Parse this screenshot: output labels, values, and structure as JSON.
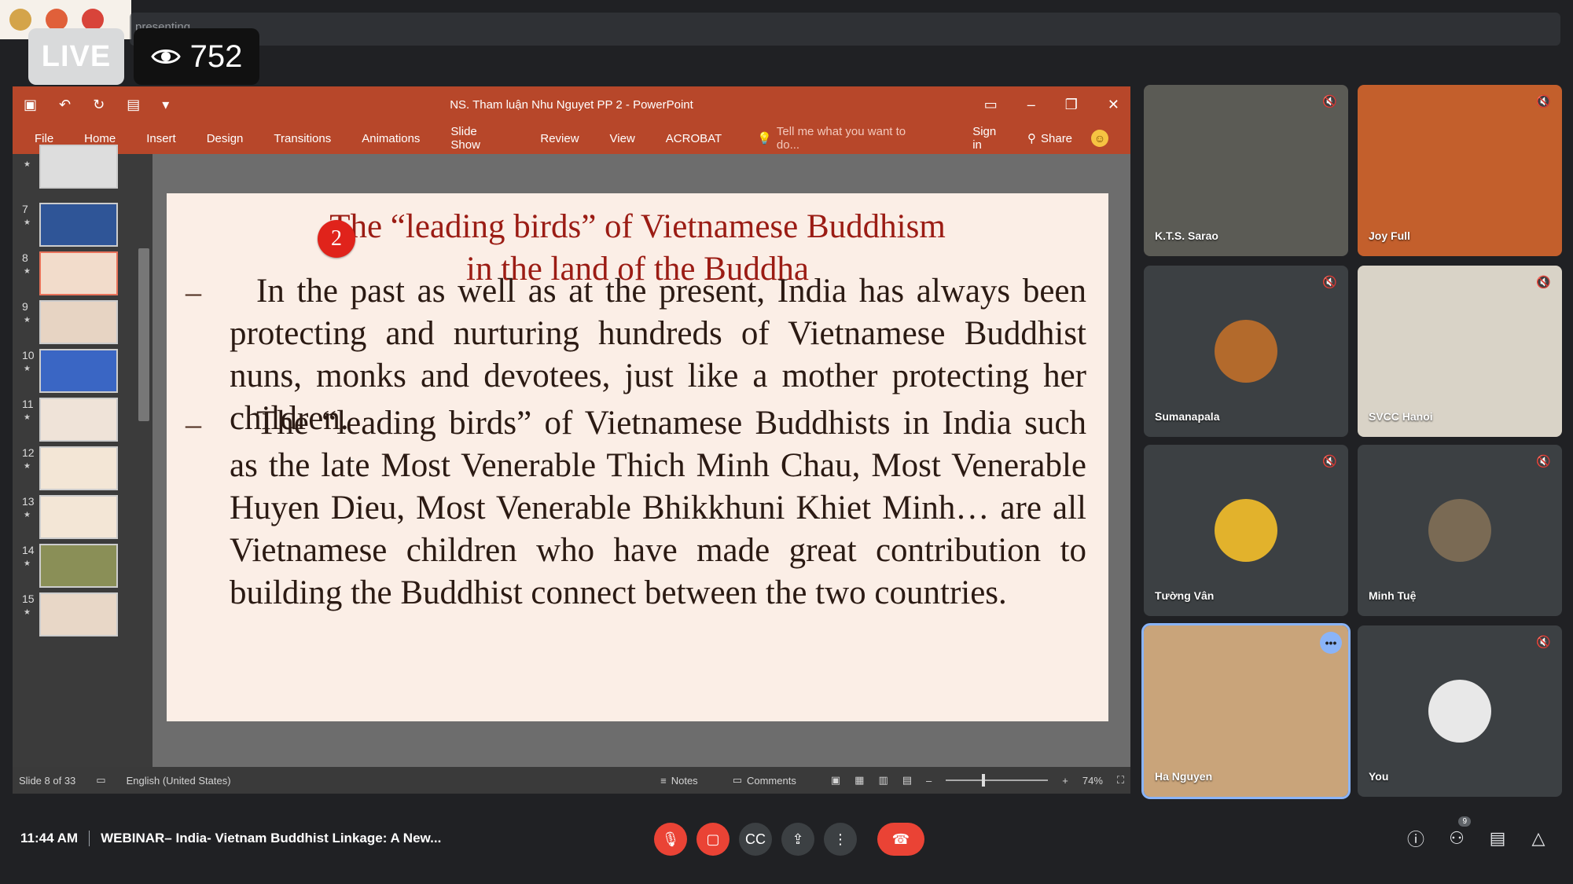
{
  "stream": {
    "live_label": "LIVE",
    "viewer_count": "752",
    "presenting_text": "presenting"
  },
  "ppt": {
    "window_title": "NS. Tham luận Nhu Nguyet PP 2 - PowerPoint",
    "tabs": [
      "File",
      "Home",
      "Insert",
      "Design",
      "Transitions",
      "Animations",
      "Slide Show",
      "Review",
      "View",
      "ACROBAT"
    ],
    "tell_me_placeholder": "Tell me what you want to do...",
    "sign_in": "Sign in",
    "share": "Share",
    "thumbnails": [
      {
        "num": "",
        "selected": false
      },
      {
        "num": "7",
        "selected": false
      },
      {
        "num": "8",
        "selected": true
      },
      {
        "num": "9",
        "selected": false
      },
      {
        "num": "10",
        "selected": false
      },
      {
        "num": "11",
        "selected": false
      },
      {
        "num": "12",
        "selected": false
      },
      {
        "num": "13",
        "selected": false
      },
      {
        "num": "14",
        "selected": false
      },
      {
        "num": "15",
        "selected": false
      }
    ],
    "slide": {
      "badge": "2",
      "title_line1": "The “leading birds” of Vietnamese Buddhism",
      "title_line2": "in the land of the Buddha",
      "bullet1": "In the past as well as at the present, India has always been protecting and nurturing hundreds of Vietnamese Buddhist nuns, monks and devotees, just like a mother protecting her children.",
      "bullet2": "The “leading birds” of Vietnamese Buddhists in India such as the late Most Venerable Thich Minh Chau, Most Venerable Huyen Dieu, Most Venerable Bhikkhuni Khiet Minh… are all Vietnamese children who have made great contribution to building the Buddhist connect between the two countries."
    },
    "status": {
      "slide_counter": "Slide 8 of 33",
      "language": "English (United States)",
      "notes": "Notes",
      "comments": "Comments",
      "zoom": "74%",
      "zoom_level": 0.74
    }
  },
  "participants": [
    {
      "name": "K.T.S. Sarao",
      "muted": true
    },
    {
      "name": "Joy Full",
      "muted": true
    },
    {
      "name": "Sumanapala",
      "muted": true
    },
    {
      "name": "SVCC Hanoi",
      "muted": true
    },
    {
      "name": "Tường Vân",
      "muted": true
    },
    {
      "name": "Minh Tuệ",
      "muted": true
    },
    {
      "name": "Ha Nguyen",
      "muted": false
    },
    {
      "name": "You",
      "muted": true
    }
  ],
  "meeting": {
    "time": "11:44 AM",
    "title": "WEBINAR– India- Vietnam Buddhist Linkage: A New...",
    "people_count": "9"
  },
  "colors": {
    "ppt_accent": "#b7472a",
    "meet_red": "#ea4335",
    "slide_title": "#9b1c14",
    "active_speaker": "#8ab4f8"
  }
}
